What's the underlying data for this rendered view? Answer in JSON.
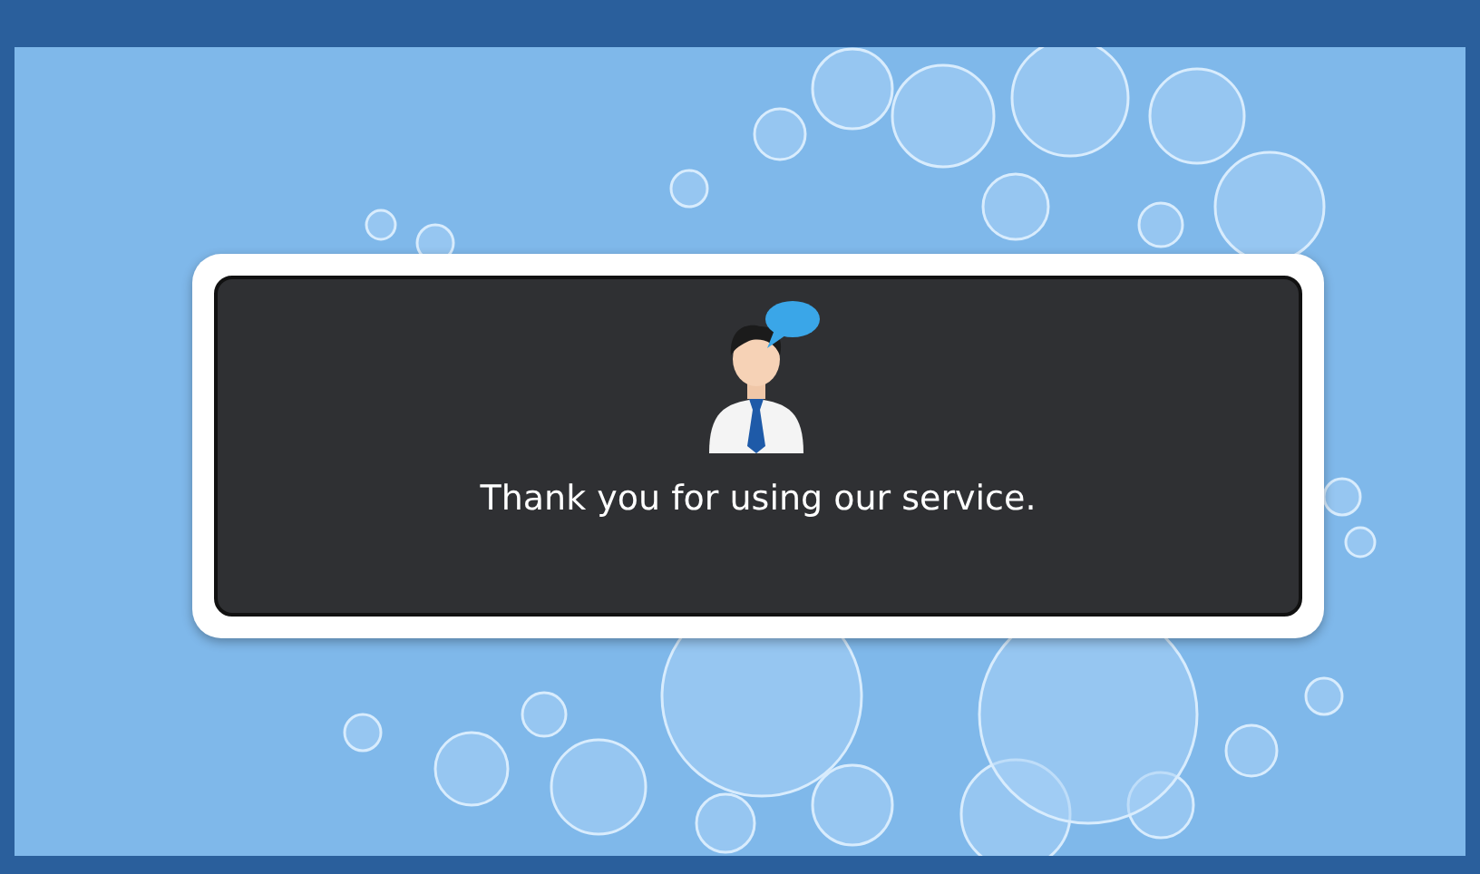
{
  "dialog": {
    "message": "Thank you for using our service."
  }
}
